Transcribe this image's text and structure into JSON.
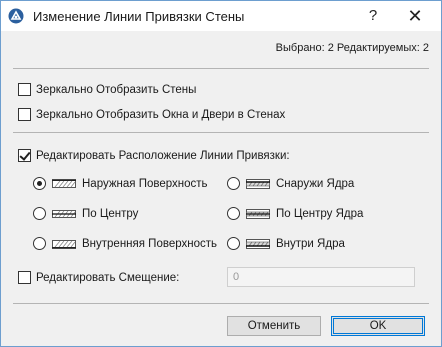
{
  "window": {
    "title": "Изменение Линии Привязки Стены",
    "help_label": "?",
    "close_label": "✕"
  },
  "selection_info": "Выбрано: 2 Редактируемых: 2",
  "options": {
    "mirror_walls": {
      "label": "Зеркально Отобразить Стены",
      "checked": false
    },
    "mirror_openings": {
      "label": "Зеркально Отобразить Окна и Двери в Стенах",
      "checked": false
    },
    "edit_reference_line": {
      "label": "Редактировать Расположение Линии Привязки:",
      "checked": true
    }
  },
  "reference_line": {
    "left": [
      {
        "label": "Наружная Поверхность",
        "icon": "wall-exterior-face-icon",
        "selected": true
      },
      {
        "label": "По Центру",
        "icon": "wall-center-icon",
        "selected": false
      },
      {
        "label": "Внутренняя Поверхность",
        "icon": "wall-interior-face-icon",
        "selected": false
      }
    ],
    "right": [
      {
        "label": "Снаружи Ядра",
        "icon": "core-exterior-icon",
        "selected": false
      },
      {
        "label": "По Центру Ядра",
        "icon": "core-center-icon",
        "selected": false
      },
      {
        "label": "Внутри Ядра",
        "icon": "core-interior-icon",
        "selected": false
      }
    ]
  },
  "offset": {
    "label": "Редактировать Смещение:",
    "checked": false,
    "value": "0"
  },
  "buttons": {
    "cancel": "Отменить",
    "ok": "OK"
  },
  "colors": {
    "window_border": "#6d9ecf",
    "accent": "#0078d7",
    "dialog_bg": "#f0f0f0"
  }
}
